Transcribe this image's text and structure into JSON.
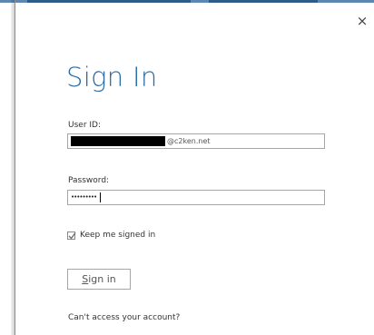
{
  "dialog": {
    "close_glyph": "×",
    "title": "Sign In",
    "user_id": {
      "label": "User ID:",
      "value_suffix": "@c2ken.net"
    },
    "password": {
      "label": "Password:",
      "masked_value": "•••••••••"
    },
    "keep_signed_in": {
      "label": "Keep me signed in",
      "checked": true
    },
    "signin_button": {
      "access_key": "S",
      "label_rest": "ign in"
    },
    "help_link": "Can't access your account?"
  },
  "icons": {
    "close": "close-icon",
    "check": "checkmark-icon"
  },
  "colors": {
    "title": "#2a6ca7",
    "input_border": "#a6a6a6",
    "text": "#333333",
    "window_edge": "#8c8c8c"
  }
}
